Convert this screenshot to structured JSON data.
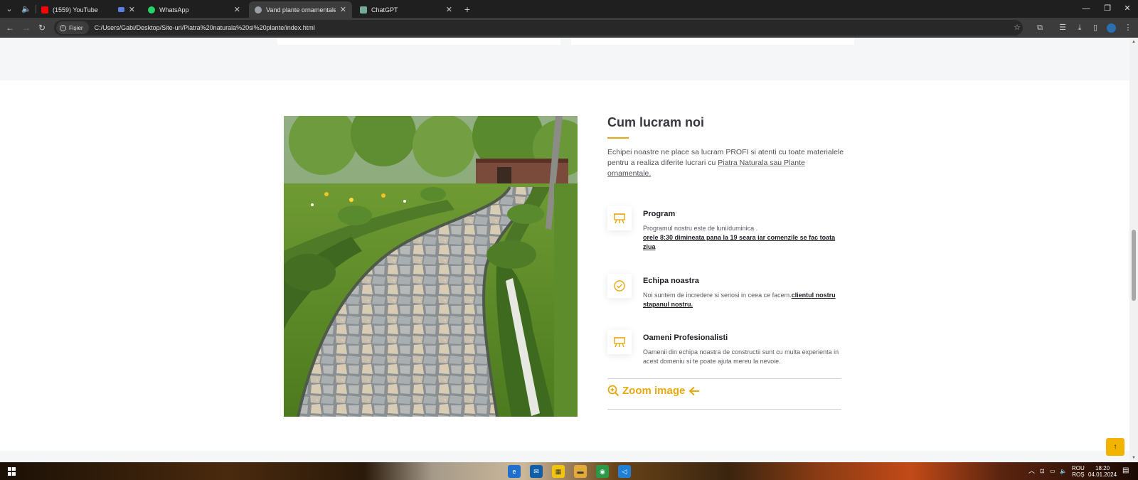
{
  "browser": {
    "tabs": [
      {
        "title": "(1559) YouTube",
        "favicon_color": "#ff0000"
      },
      {
        "title": "WhatsApp",
        "favicon_color": "#25d366"
      },
      {
        "title": "Vand plante ornamentale de to",
        "favicon_color": "#9aa0a6"
      },
      {
        "title": "ChatGPT",
        "favicon_color": "#74aa9c"
      }
    ],
    "site_chip": "Fișier",
    "url": "C:/Users/Gabi/Desktop/Site-uri/Piatra%20naturala%20si%20plante/index.html"
  },
  "section": {
    "title": "Cum lucram noi",
    "intro": "Echipei noastre ne place sa lucram PROFI si atenti cu toate materialele pentru a realiza diferite lucrari cu ",
    "intro_link": "Piatra Naturala sau Plante ornamentale.",
    "features": [
      {
        "icon": "easel-icon",
        "title": "Program",
        "text": "Programul nostru este de luni/duminica .",
        "highlight": "orele 8:30 dimineata pana la 19 seara iar comenzile se fac toata ziua"
      },
      {
        "icon": "check-circle-icon",
        "title": "Echipa noastra",
        "text": "Noi suntem de incredere si seriosi in ceea ce facem.",
        "highlight": "clientul nostru stapanul nostru."
      },
      {
        "icon": "easel-icon",
        "title": "Oameni Profesionalisti",
        "text": "Oamenii din echipa noastra de constructii sunt cu multa experienta in acest domeniu si te poate ajuta mereu la nevoie.",
        "highlight": ""
      }
    ],
    "zoom_label": "Zoom image"
  },
  "colors": {
    "accent": "#e8a80f",
    "back_to_top": "#f2b400"
  },
  "taskbar": {
    "lang_top": "ROU",
    "lang_bottom": "ROȘ",
    "time": "18:20",
    "date": "04.01.2024"
  }
}
